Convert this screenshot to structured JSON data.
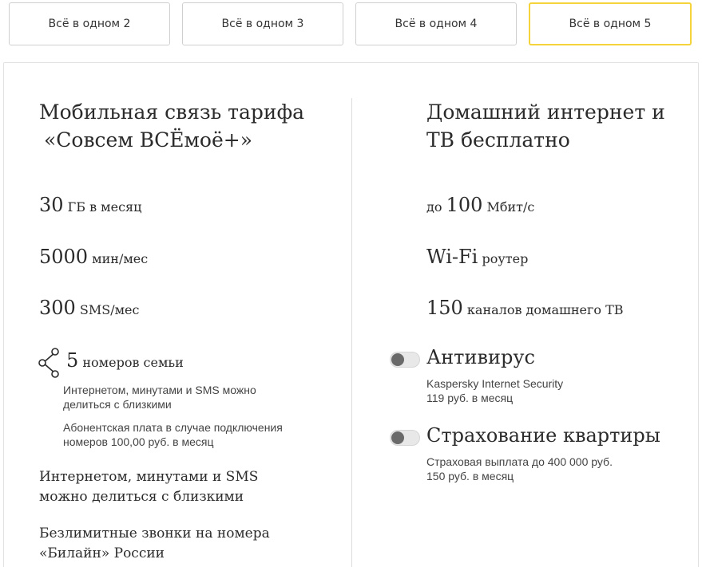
{
  "tabs": [
    {
      "label": "Всё в одном 2",
      "active": false
    },
    {
      "label": "Всё в одном 3",
      "active": false
    },
    {
      "label": "Всё в одном 4",
      "active": false
    },
    {
      "label": "Всё в одном 5",
      "active": true
    }
  ],
  "left": {
    "heading_line1": "Мобильная связь тарифа",
    "heading_line2": "«Совсем ВСЁмоё+»",
    "data": {
      "amount": "30",
      "unit": "ГБ в месяц"
    },
    "minutes": {
      "amount": "5000",
      "unit": "мин/мес"
    },
    "sms": {
      "amount": "300",
      "unit": "SMS/мес"
    },
    "family": {
      "amount": "5",
      "unit": "номеров семьи",
      "icon": "share-icon"
    },
    "family_note1_line1": "Интернетом, минутами и SMS можно",
    "family_note1_line2": "делиться с близкими",
    "family_note2_line1": "Абонентская плата в случае подключения",
    "family_note2_line2": "номеров 100,00 руб. в месяц",
    "share_line1": "Интернетом, минутами и SMS",
    "share_line2": "можно делиться с близкими",
    "unlimited_line1": "Безлимитные звонки на номера",
    "unlimited_line2": "«Билайн» России"
  },
  "right": {
    "heading_line1": "Домашний интернет и",
    "heading_line2": "ТВ бесплатно",
    "speed": {
      "prefix": "до",
      "amount": "100",
      "unit": "Мбит/с"
    },
    "wifi": {
      "amount": "Wi-Fi",
      "unit": "роутер"
    },
    "tv": {
      "amount": "150",
      "unit": "каналов домашнего ТВ"
    },
    "antivirus": {
      "title": "Антивирус",
      "line1": "Kaspersky Internet Security",
      "line2": "119 руб. в месяц",
      "enabled": false
    },
    "insurance": {
      "title": "Страхование квартиры",
      "line1": "Страховая выплата до 400 000 руб.",
      "line2": "150 руб. в месяц",
      "enabled": false
    }
  },
  "colors": {
    "active_tab_border": "#f5d33a",
    "toggle_knob": "#6a6a6a"
  }
}
